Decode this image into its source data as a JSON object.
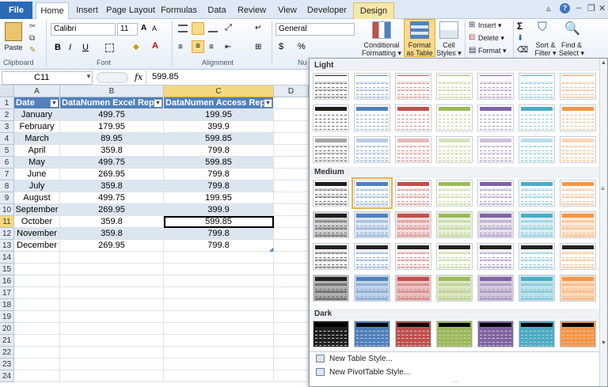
{
  "tabs": {
    "file": "File",
    "home": "Home",
    "insert": "Insert",
    "page_layout": "Page Layout",
    "formulas": "Formulas",
    "data": "Data",
    "review": "Review",
    "view": "View",
    "developer": "Developer",
    "design": "Design"
  },
  "ribbon": {
    "paste": "Paste",
    "font_name": "Calibri",
    "font_size": "11",
    "number_format": "General",
    "conditional_formatting": [
      "Conditional",
      "Formatting ▾"
    ],
    "format_as_table": [
      "Format",
      "as Table ▾"
    ],
    "cell_styles": [
      "Cell",
      "Styles ▾"
    ],
    "insert": "Insert ▾",
    "delete": "Delete ▾",
    "format": "Format ▾",
    "sort_filter": [
      "Sort &",
      "Filter ▾"
    ],
    "find_select": [
      "Find &",
      "Select ▾"
    ],
    "groups": {
      "clipboard": "Clipboard",
      "font": "Font",
      "alignment": "Alignment",
      "number": "Nu"
    },
    "bold": "B",
    "italic": "I",
    "underline": "U",
    "dollar": "$",
    "percent": "%",
    "comma": ","
  },
  "formula_bar": {
    "name_box": "C11",
    "fx": "fx",
    "value": "599.85"
  },
  "columns": [
    "A",
    "B",
    "C",
    "D"
  ],
  "table": {
    "headers": [
      "Date",
      "DataNumen Excel Repa",
      "DataNumen Access Repa"
    ],
    "rows": [
      [
        "January",
        "499.75",
        "199.95"
      ],
      [
        "February",
        "179.95",
        "399.9"
      ],
      [
        "March",
        "89.95",
        "599.85"
      ],
      [
        "April",
        "359.8",
        "799.8"
      ],
      [
        "May",
        "499.75",
        "599.85"
      ],
      [
        "June",
        "269.95",
        "799.8"
      ],
      [
        "July",
        "359.8",
        "799.8"
      ],
      [
        "August",
        "499.75",
        "199.95"
      ],
      [
        "September",
        "269.95",
        "399.9"
      ],
      [
        "October",
        "359.8",
        "599.85"
      ],
      [
        "November",
        "359.8",
        "799.8"
      ],
      [
        "December",
        "269.95",
        "799.8"
      ]
    ]
  },
  "row_numbers": [
    "1",
    "2",
    "3",
    "4",
    "5",
    "6",
    "7",
    "8",
    "9",
    "10",
    "11",
    "12",
    "13",
    "14",
    "15",
    "16",
    "17",
    "18",
    "19",
    "20",
    "21",
    "22",
    "23",
    "24"
  ],
  "gallery": {
    "light": "Light",
    "medium": "Medium",
    "dark": "Dark",
    "new_table_style": "New Table Style...",
    "new_pivot_style": "New PivotTable Style...",
    "palette": [
      "#1f1f1f",
      "#4f81bd",
      "#c0504d",
      "#9bbb59",
      "#8064a2",
      "#4bacc6",
      "#f79646"
    ]
  }
}
